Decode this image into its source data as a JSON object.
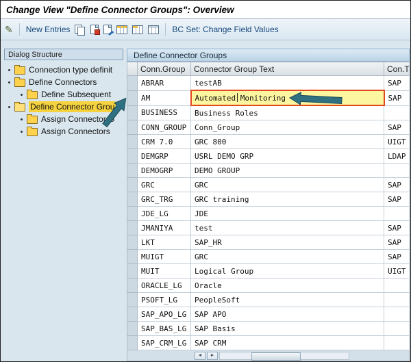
{
  "title": "Change View \"Define Connector Groups\": Overview",
  "icons": {
    "pencil": "✎"
  },
  "toolbar": {
    "new_entries_label": "New Entries",
    "bc_set_label": "BC Set: Change Field Values"
  },
  "dialog_structure": {
    "title": "Dialog Structure",
    "items": [
      {
        "label": "Connection type definit",
        "level": 0,
        "selected": false
      },
      {
        "label": "Define Connectors",
        "level": 0,
        "selected": false
      },
      {
        "label": "Define Subsequent",
        "level": 1,
        "selected": false
      },
      {
        "label": "Define Connector Grou",
        "level": 0,
        "selected": true
      },
      {
        "label": "Assign Connector G",
        "level": 1,
        "selected": false
      },
      {
        "label": "Assign Connectors",
        "level": 1,
        "selected": false
      }
    ]
  },
  "table": {
    "title": "Define Connector Groups",
    "columns": [
      "Conn.Group",
      "Connector Group Text",
      "Con.T"
    ],
    "rows": [
      {
        "group": "ABRAR",
        "text": "testAB",
        "type": "SAP",
        "highlighted": false
      },
      {
        "group": "AM",
        "text": "Automated Monitoring",
        "type": "SAP",
        "highlighted": true
      },
      {
        "group": "BUSINESS",
        "text": "Business Roles",
        "type": "",
        "highlighted": false
      },
      {
        "group": "CONN_GROUP",
        "text": "Conn_Group",
        "type": "SAP",
        "highlighted": false
      },
      {
        "group": "CRM 7.0",
        "text": "GRC 800",
        "type": "UIGT",
        "highlighted": false
      },
      {
        "group": "DEMGRP",
        "text": "USRL DEMO GRP",
        "type": "LDAP",
        "highlighted": false
      },
      {
        "group": "DEMOGRP",
        "text": "DEMO GROUP",
        "type": "",
        "highlighted": false
      },
      {
        "group": "GRC",
        "text": "GRC",
        "type": "SAP",
        "highlighted": false
      },
      {
        "group": "GRC_TRG",
        "text": "GRC training",
        "type": "SAP",
        "highlighted": false
      },
      {
        "group": "JDE_LG",
        "text": "JDE",
        "type": "",
        "highlighted": false
      },
      {
        "group": "JMANIYA",
        "text": "test",
        "type": "SAP",
        "highlighted": false
      },
      {
        "group": "LKT",
        "text": "SAP_HR",
        "type": "SAP",
        "highlighted": false
      },
      {
        "group": "MUIGT",
        "text": "GRC",
        "type": "SAP",
        "highlighted": false
      },
      {
        "group": "MUIT",
        "text": "Logical Group",
        "type": "UIGT",
        "highlighted": false
      },
      {
        "group": "ORACLE_LG",
        "text": "Oracle",
        "type": "",
        "highlighted": false
      },
      {
        "group": "PSOFT_LG",
        "text": "PeopleSoft",
        "type": "",
        "highlighted": false
      },
      {
        "group": "SAP_APO_LG",
        "text": "SAP APO",
        "type": "",
        "highlighted": false
      },
      {
        "group": "SAP_BAS_LG",
        "text": "SAP Basis",
        "type": "",
        "highlighted": false
      },
      {
        "group": "SAP_CRM_LG",
        "text": "SAP CRM",
        "type": "",
        "highlighted": false
      }
    ]
  },
  "scrollbar": {
    "left_arrow": "◄",
    "right_arrow": "►"
  },
  "annotation_color": "#2f7180"
}
